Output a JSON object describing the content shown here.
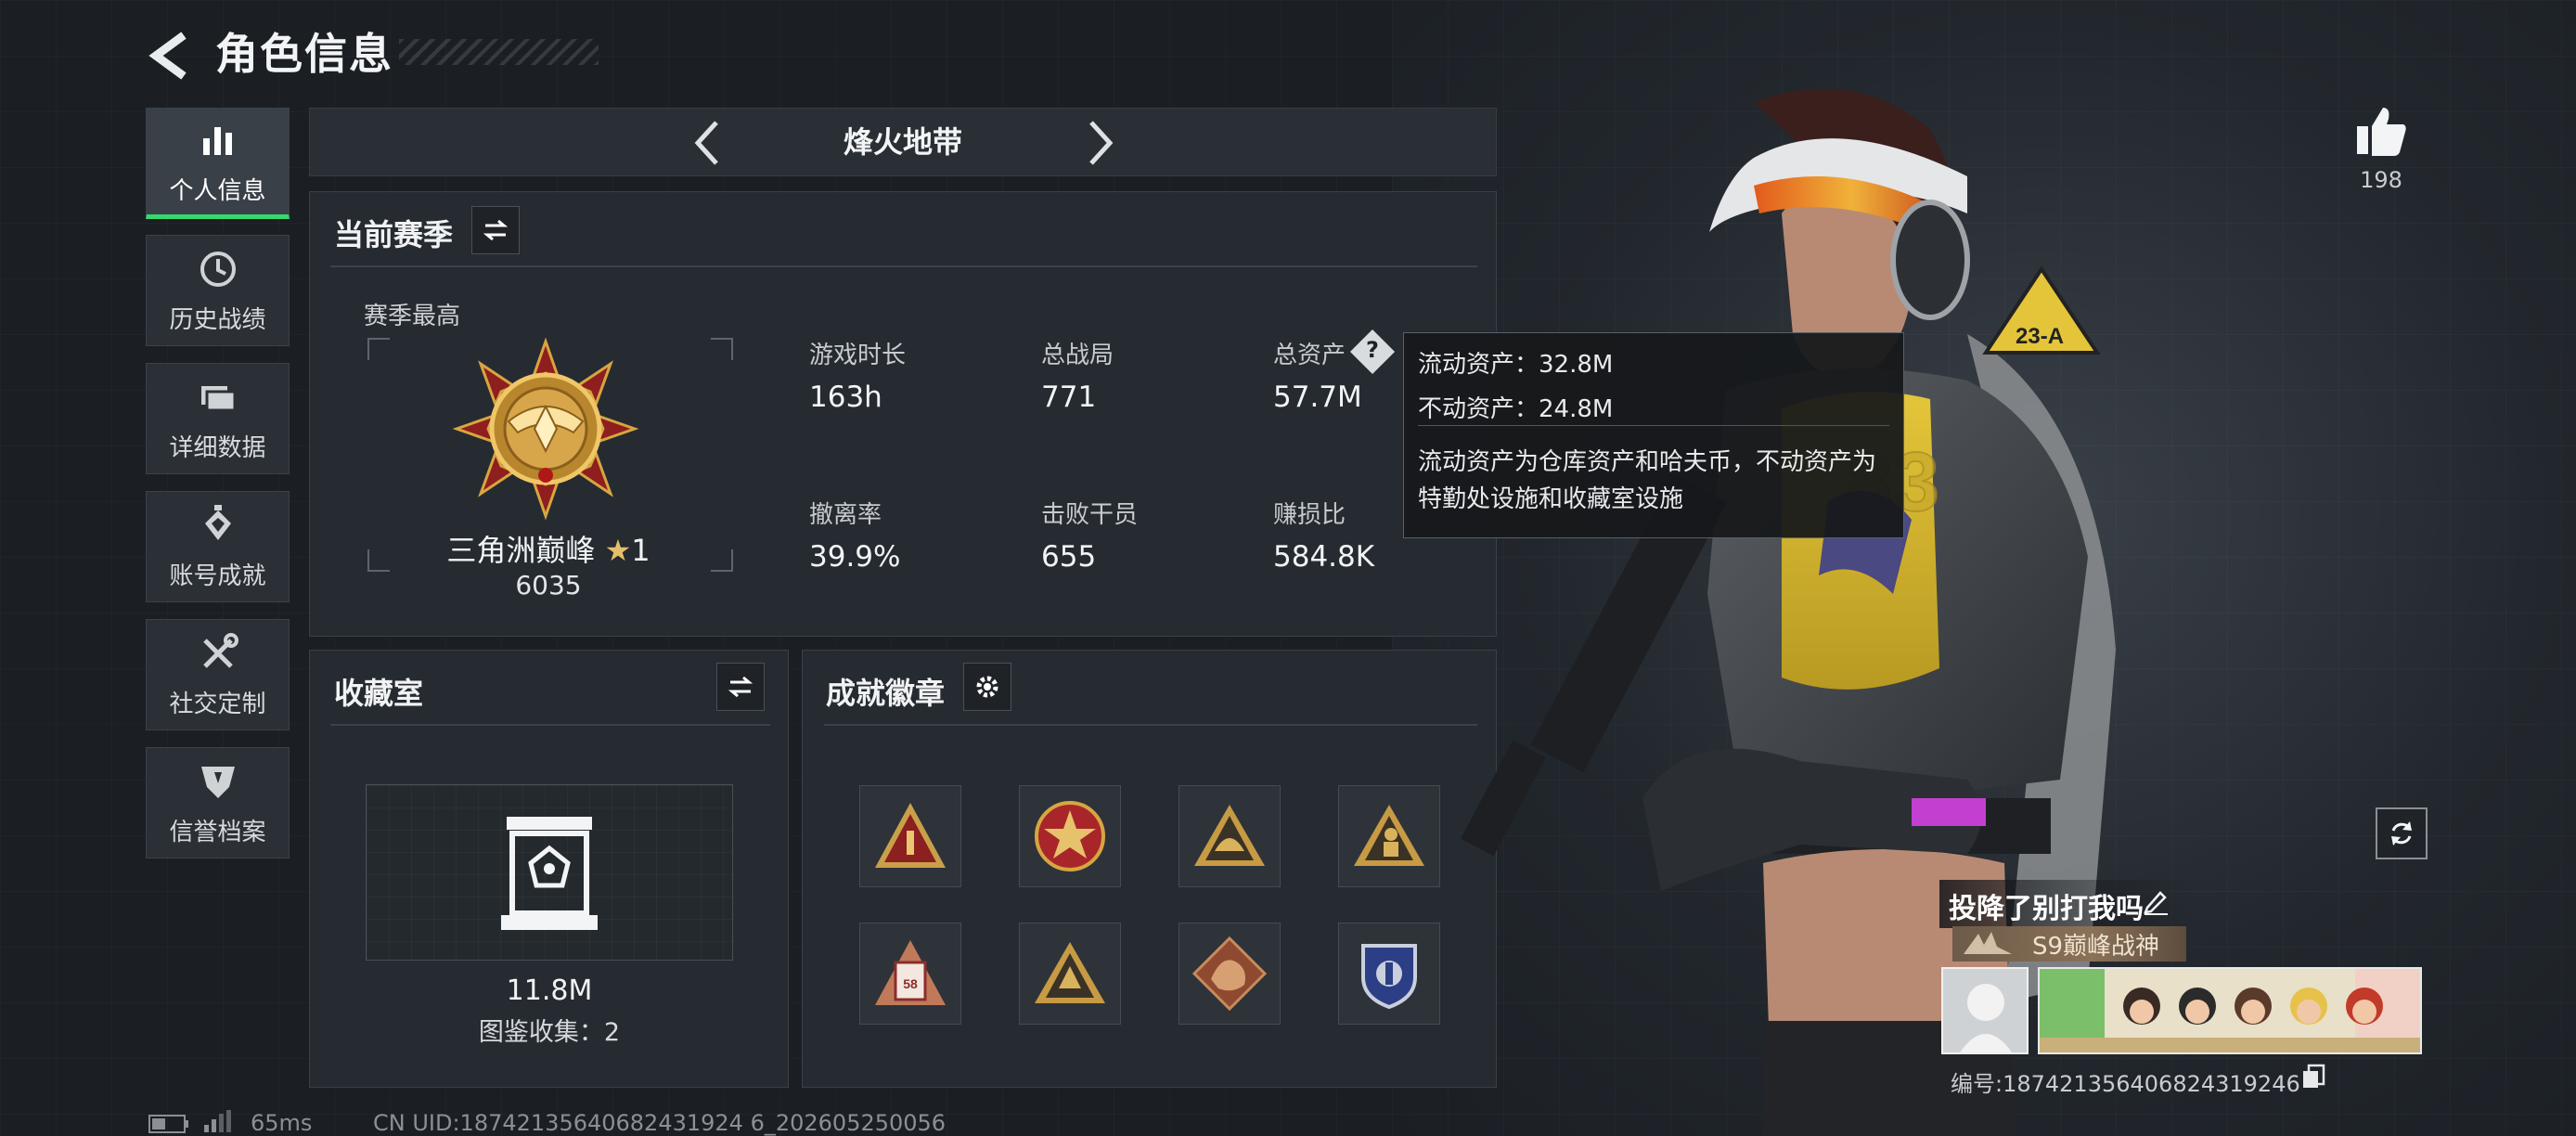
{
  "header": {
    "title": "角色信息"
  },
  "sidebar": {
    "items": [
      {
        "label": "个人信息",
        "icon": "bar-chart-icon",
        "active": true
      },
      {
        "label": "历史战绩",
        "icon": "clock-icon",
        "active": false
      },
      {
        "label": "详细数据",
        "icon": "folder-icon",
        "active": false
      },
      {
        "label": "账号成就",
        "icon": "medal-icon",
        "active": false
      },
      {
        "label": "社交定制",
        "icon": "tools-icon",
        "active": false
      },
      {
        "label": "信誉档案",
        "icon": "shield-icon",
        "active": false
      }
    ]
  },
  "mode": {
    "title": "烽火地带"
  },
  "season": {
    "title": "当前赛季",
    "best_label": "赛季最高",
    "rank_name": "三角洲巅峰",
    "rank_star": "★",
    "rank_level": "1",
    "rank_score": "6035",
    "stats": [
      {
        "label": "游戏时长",
        "value": "163h"
      },
      {
        "label": "总战局",
        "value": "771"
      },
      {
        "label": "总资产",
        "value": "57.7M"
      },
      {
        "label": "撤离率",
        "value": "39.9%"
      },
      {
        "label": "击败干员",
        "value": "655"
      },
      {
        "label": "赚损比",
        "value": "584.8K"
      }
    ],
    "help_glyph": "?"
  },
  "tooltip": {
    "liquid": "流动资产：32.8M",
    "fixed": "不动资产：24.8M",
    "desc": "流动资产为仓库资产和哈夫币，不动资产为特勤处设施和收藏室设施"
  },
  "collection": {
    "title": "收藏室",
    "value": "11.8M",
    "count_text": "图鉴收集：2"
  },
  "achievements": {
    "title": "成就徽章",
    "badges": [
      {
        "icon": "rank-one-badge-icon"
      },
      {
        "icon": "star-emblem-badge-icon"
      },
      {
        "icon": "helmet-badge-icon"
      },
      {
        "icon": "figure-badge-icon"
      },
      {
        "icon": "building-58-badge-icon",
        "label": "58"
      },
      {
        "icon": "crest-badge-icon"
      },
      {
        "icon": "dragon-badge-icon"
      },
      {
        "icon": "police-shield-badge-icon"
      }
    ]
  },
  "character": {
    "patch": "23-A",
    "chest_number": "83"
  },
  "profile": {
    "likes": "198",
    "nickname": "投降了别打我吗",
    "title": "S9巅峰战神",
    "uid_text": "编号:18742135640682431924​6"
  },
  "status_bar": {
    "ping": "65ms",
    "uid": "CN UID:18742135640682431924 6_202605250056"
  },
  "colors": {
    "accent_green": "#35d96e",
    "background": "#1b1f24",
    "panel": "#262b31"
  }
}
